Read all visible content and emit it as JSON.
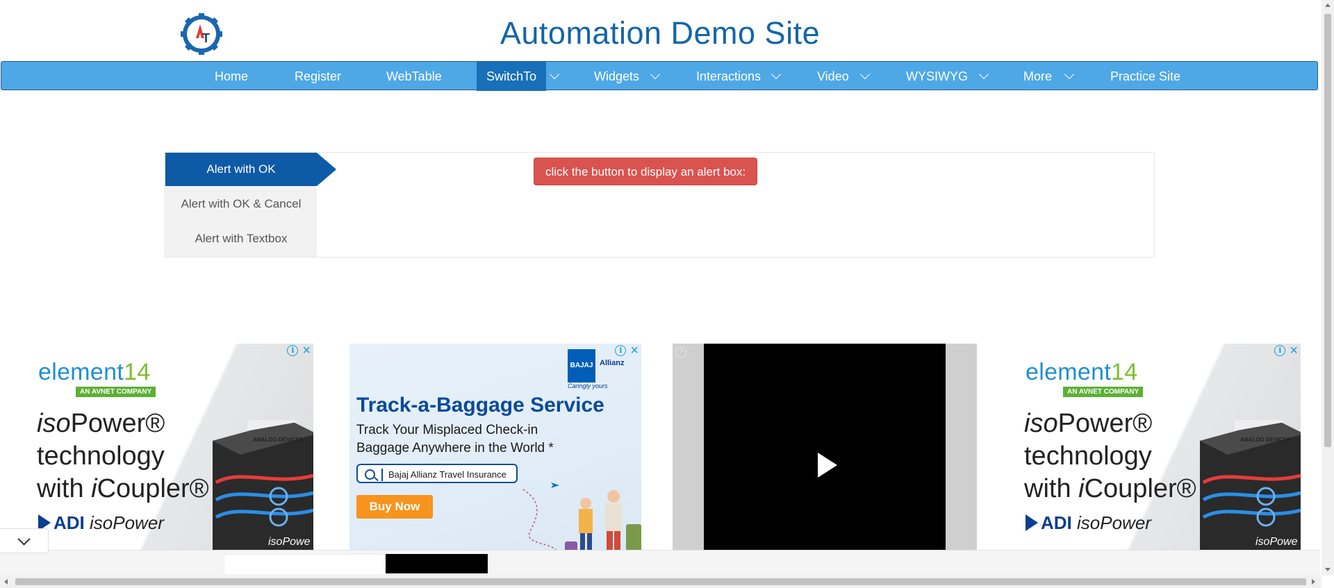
{
  "header": {
    "title": "Automation Demo Site",
    "logo_icon": "gear-logo-icon"
  },
  "nav": {
    "items": [
      {
        "label": "Home",
        "has_dropdown": false
      },
      {
        "label": "Register",
        "has_dropdown": false
      },
      {
        "label": "WebTable",
        "has_dropdown": false
      },
      {
        "label": "SwitchTo",
        "has_dropdown": true,
        "active": true
      },
      {
        "label": "Widgets",
        "has_dropdown": true
      },
      {
        "label": "Interactions",
        "has_dropdown": true
      },
      {
        "label": "Video",
        "has_dropdown": true
      },
      {
        "label": "WYSIWYG",
        "has_dropdown": true
      },
      {
        "label": "More",
        "has_dropdown": true
      },
      {
        "label": "Practice Site",
        "has_dropdown": false
      }
    ]
  },
  "alerts": {
    "tabs": [
      {
        "label": "Alert with OK",
        "active": true
      },
      {
        "label": "Alert with OK & Cancel"
      },
      {
        "label": "Alert with Textbox"
      }
    ],
    "button_label": "click the button to display an alert box:"
  },
  "ads": {
    "element14": {
      "brand": "element",
      "brand_num": "14",
      "tagline": "AN AVNET COMPANY",
      "line1_iso": "iso",
      "line1_rest": "Power®",
      "line2": "technology",
      "line3_pre": "with ",
      "line3_i": "i",
      "line3_rest": "Coupler®",
      "footer_brand": "ADI",
      "footer_product": "isoPower",
      "chip_label": "ANALOG DEVICES",
      "chip_footer": "isoPowe"
    },
    "bajaj": {
      "logo_text": "BAJAJ",
      "allianz": "Allianz",
      "tagline": "Caringly yours",
      "title": "Track-a-Baggage Service",
      "sub_line1": "Track Your Misplaced Check-in",
      "sub_line2": "Baggage Anywhere in the World *",
      "search_text": "Bajaj Allianz Travel Insurance",
      "cta": "Buy Now"
    },
    "info_icon": "info-icon",
    "close_icon": "close-icon",
    "video_help": "?"
  },
  "colors": {
    "nav_bg": "#4ea8e6",
    "nav_active": "#1770b8",
    "title_blue": "#1465a9",
    "tab_active": "#0d5aa6",
    "alert_red": "#d9534f"
  }
}
